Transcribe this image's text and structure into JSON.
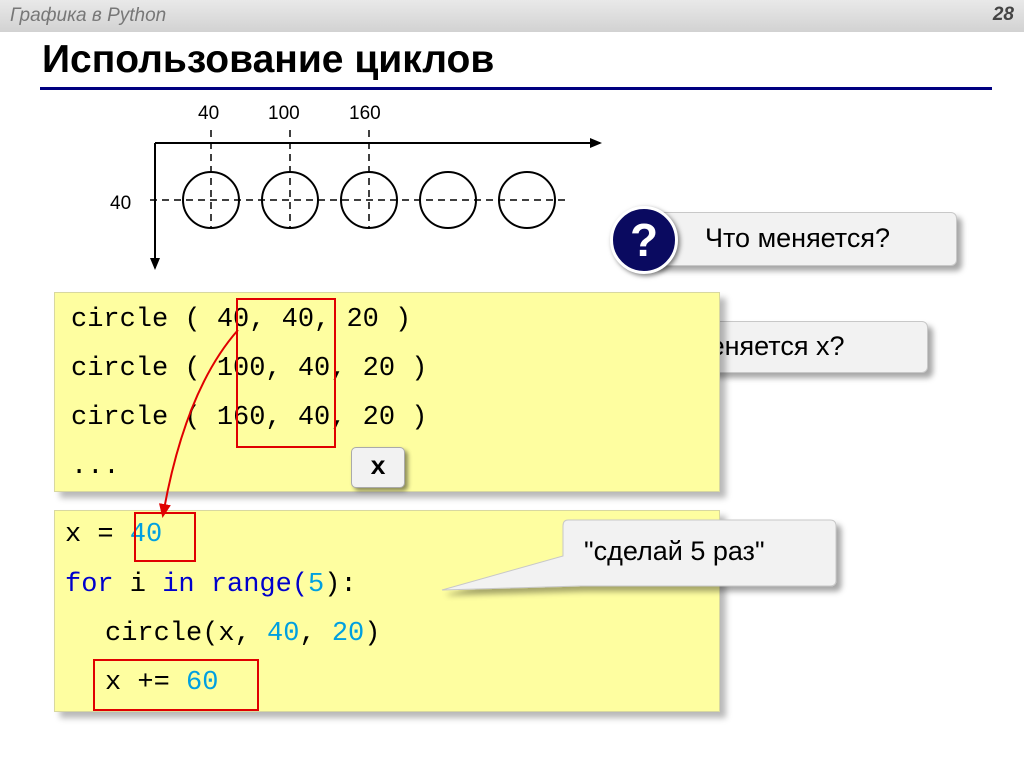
{
  "header": {
    "course": "Графика в Python",
    "page_number": "28"
  },
  "title": "Использование циклов",
  "diagram": {
    "x_ticks": [
      "40",
      "100",
      "160"
    ],
    "y_tick": "40"
  },
  "questions": [
    {
      "icon": "?",
      "text": "Что меняется?"
    },
    {
      "icon": "?",
      "text": "Как меняется x?"
    }
  ],
  "code1": {
    "lines": [
      {
        "fn": "circle",
        "arg1": "40,",
        "rest": " 40, 20 )"
      },
      {
        "fn": "circle",
        "arg1": "100,",
        "rest": " 40, 20 )"
      },
      {
        "fn": "circle",
        "arg1": "160,",
        "rest": " 40, 20 )"
      }
    ],
    "ellipsis": "...",
    "label": "x"
  },
  "code2": {
    "assign": "x = ",
    "assign_value": "40",
    "for_kw": "for",
    "for_var": " i ",
    "in_kw": "in",
    "range_fn": " range(",
    "range_arg": "5",
    "range_close": "):",
    "call_start": "circle(x, ",
    "call_a": "40",
    "call_comma": ", ",
    "call_b": "20",
    "call_end": ")",
    "inc_op": "x += ",
    "inc_value": "60"
  },
  "callout": "\"сделай 5 раз\"",
  "colors": {
    "keyword": "#0000cc",
    "number": "#00a0e0",
    "highlight_box": "#e00000",
    "code_bg": "#fefea0",
    "title_rule": "#000080"
  }
}
